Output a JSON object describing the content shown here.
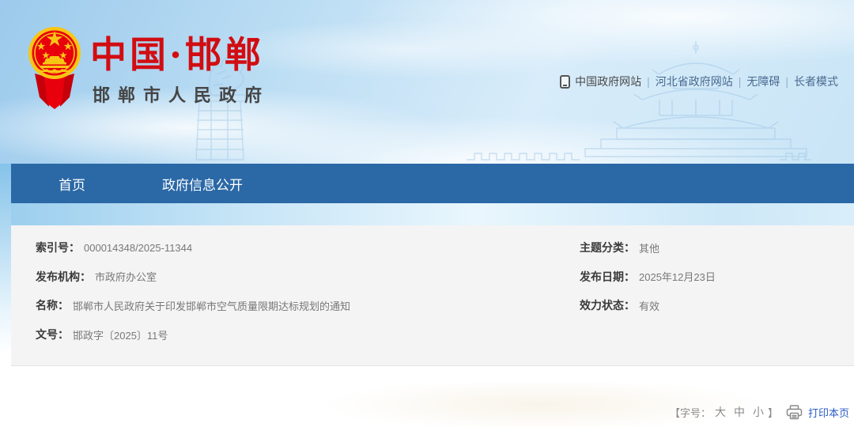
{
  "header": {
    "site_name": "中国·邯郸",
    "site_subtitle": "邯郸市人民政府",
    "top_links": [
      {
        "label": "中国政府网站"
      },
      {
        "label": "河北省政府网站"
      },
      {
        "label": "无障碍"
      },
      {
        "label": "长者模式"
      }
    ],
    "separator": "|"
  },
  "nav": {
    "items": [
      {
        "label": "首页"
      },
      {
        "label": "政府信息公开"
      }
    ]
  },
  "meta_table": {
    "rows_left": [
      {
        "label": "索引号：",
        "value": "000014348/2025-11344"
      },
      {
        "label": "发布机构：",
        "value": "市政府办公室"
      },
      {
        "label": "名称：",
        "value": "邯郸市人民政府关于印发邯郸市空气质量限期达标规划的通知"
      },
      {
        "label": "文号：",
        "value": "邯政字〔2025〕11号"
      }
    ],
    "rows_right": [
      {
        "label": "主题分类：",
        "value": "其他"
      },
      {
        "label": "发布日期：",
        "value": "2025年12月23日"
      },
      {
        "label": "效力状态：",
        "value": "有效"
      }
    ]
  },
  "footer_tools": {
    "font_size_prefix": "【字号：",
    "font_sizes": [
      "大",
      "中",
      "小"
    ],
    "font_size_suffix": "】",
    "print_label": "打印本页"
  },
  "icons": {
    "emblem": "national-emblem",
    "device": "mobile-device-icon",
    "printer": "printer-icon"
  },
  "colors": {
    "brand_red": "#d10d12",
    "nav_blue": "#2b68a6",
    "link_blue": "#2b5cc5",
    "subtitle_gray": "#454545"
  }
}
